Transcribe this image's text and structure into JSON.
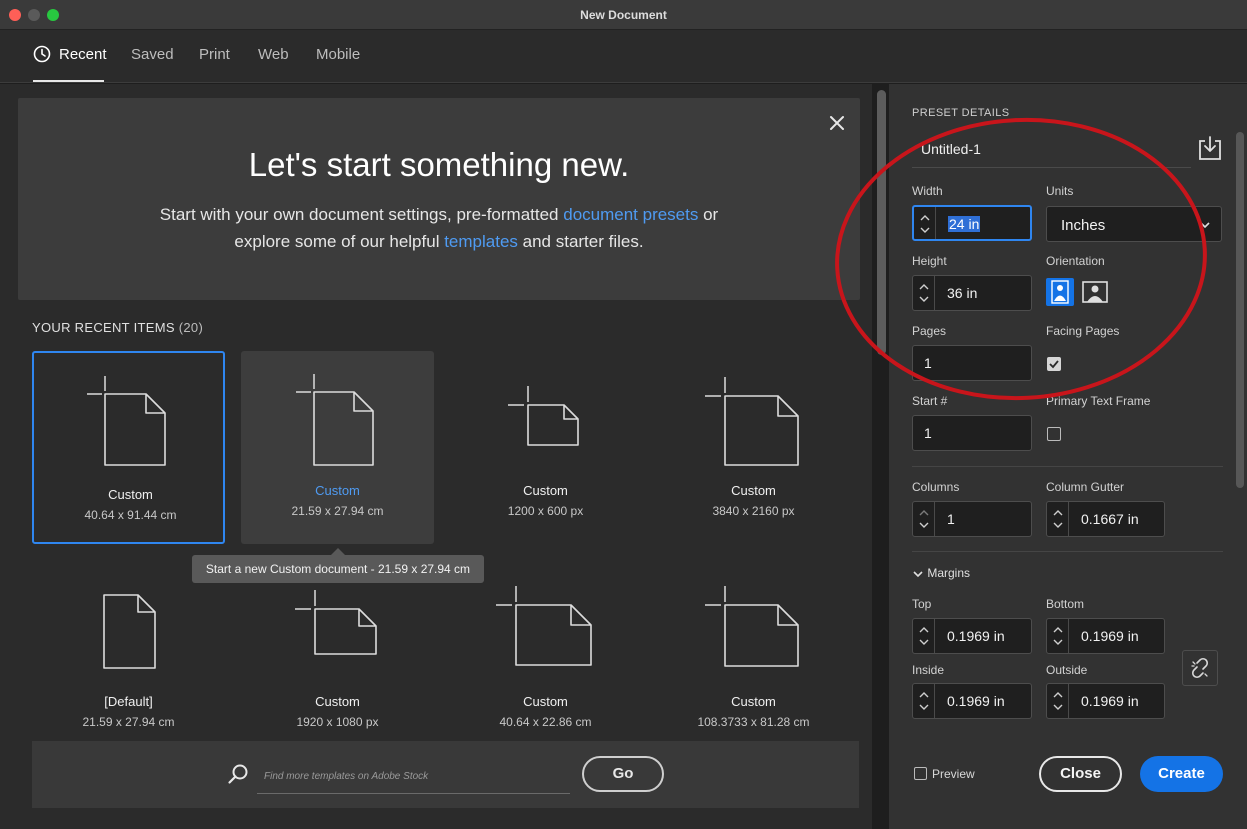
{
  "window": {
    "title": "New Document"
  },
  "tabs": [
    {
      "label": "Recent",
      "active": true
    },
    {
      "label": "Saved"
    },
    {
      "label": "Print"
    },
    {
      "label": "Web"
    },
    {
      "label": "Mobile"
    }
  ],
  "hero": {
    "title": "Let's start something new.",
    "line1_pre": "Start with your own document settings, pre-formatted ",
    "line1_link": "document presets",
    "line1_post": " or",
    "line2_pre": "explore some of our helpful ",
    "line2_link": "templates",
    "line2_post": " and starter files."
  },
  "recent": {
    "header": "YOUR RECENT ITEMS",
    "count": "(20)",
    "items": [
      {
        "name": "Custom",
        "size": "40.64 x 91.44 cm"
      },
      {
        "name": "Custom",
        "size": "21.59 x 27.94 cm"
      },
      {
        "name": "Custom",
        "size": "1200 x 600 px"
      },
      {
        "name": "Custom",
        "size": "3840 x 2160 px"
      },
      {
        "name": "[Default]",
        "size": "21.59 x 27.94 cm"
      },
      {
        "name": "Custom",
        "size": "1920 x 1080 px"
      },
      {
        "name": "Custom",
        "size": "40.64 x 22.86 cm"
      },
      {
        "name": "Custom",
        "size": "108.3733 x 81.28 cm"
      }
    ]
  },
  "tooltip": "Start a new Custom document - 21.59 x 27.94 cm",
  "stock": {
    "placeholder": "Find more templates on Adobe Stock",
    "go_label": "Go"
  },
  "preset": {
    "section_title": "PRESET DETAILS",
    "name": "Untitled-1",
    "width_label": "Width",
    "width_value": "24 in",
    "units_label": "Units",
    "units_value": "Inches",
    "height_label": "Height",
    "height_value": "36 in",
    "orientation_label": "Orientation",
    "pages_label": "Pages",
    "pages_value": "1",
    "facing_label": "Facing Pages",
    "facing_checked": true,
    "start_label": "Start #",
    "start_value": "1",
    "ptf_label": "Primary Text Frame",
    "ptf_checked": false,
    "columns_label": "Columns",
    "columns_value": "1",
    "gutter_label": "Column Gutter",
    "gutter_value": "0.1667 in",
    "margins_label": "Margins",
    "top_label": "Top",
    "top_value": "0.1969 in",
    "bottom_label": "Bottom",
    "bottom_value": "0.1969 in",
    "inside_label": "Inside",
    "inside_value": "0.1969 in",
    "outside_label": "Outside",
    "outside_value": "0.1969 in"
  },
  "footer": {
    "preview_label": "Preview",
    "close_label": "Close",
    "create_label": "Create"
  },
  "colors": {
    "accent": "#1473e6",
    "link": "#4f9bf2",
    "annotation": "#c8151b"
  }
}
